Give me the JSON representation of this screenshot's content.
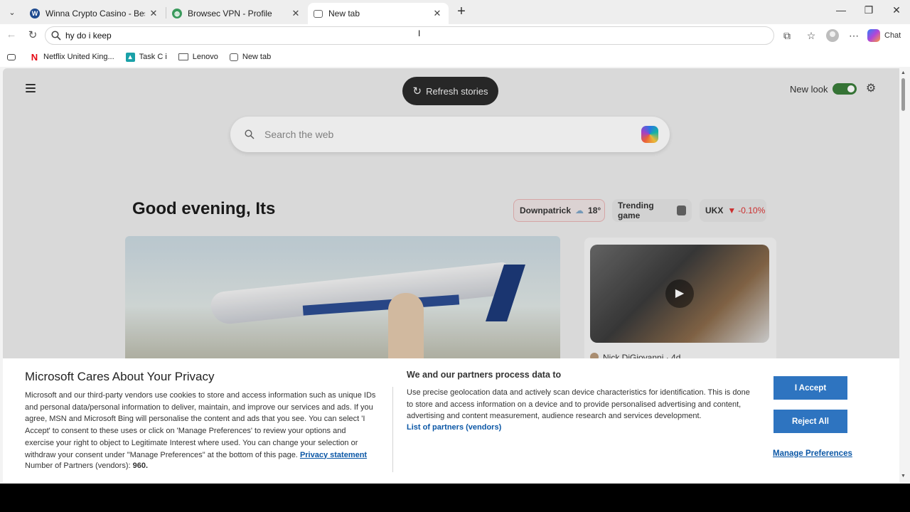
{
  "tabs": [
    {
      "title": "Winna Crypto Casino - Best Crypto",
      "icon": "wordpress-icon",
      "active": false
    },
    {
      "title": "Browsec VPN - Profile",
      "icon": "globe-icon",
      "active": false
    },
    {
      "title": "New tab",
      "icon": "newtab-icon",
      "active": true
    }
  ],
  "address_bar": {
    "value": "hy do i keep"
  },
  "toolbar": {
    "chat_label": "Chat"
  },
  "bookmarks": [
    {
      "label": "Netflix United King...",
      "icon": "netflix-icon"
    },
    {
      "label": "Task C i",
      "icon": "task-icon"
    },
    {
      "label": "Lenovo",
      "icon": "folder-icon"
    },
    {
      "label": "New tab",
      "icon": "newtab-icon"
    }
  ],
  "page": {
    "refresh_label": "Refresh stories",
    "new_look_label": "New look",
    "new_look_enabled": true,
    "search_placeholder": "Search the web",
    "greeting": "Good evening, Its",
    "weather": {
      "location": "Downpatrick",
      "temp": "18°"
    },
    "trending": {
      "label": "Trending game"
    },
    "market": {
      "symbol": "UKX",
      "change": "-0.10%",
      "direction": "down"
    },
    "video_author": "Nick DiGiovanni · 4d"
  },
  "privacy": {
    "title": "Microsoft Cares About Your Privacy",
    "body": "Microsoft and our third-party vendors use cookies to store and access information such as unique IDs and personal data/personal information to deliver, maintain, and improve our services and ads. If you agree, MSN and Microsoft Bing will personalise the content and ads that you see. You can select 'I Accept' to consent to these uses or click on 'Manage Preferences' to review your options and exercise your right to object to Legitimate Interest where used. You can change your selection or withdraw your consent under \"Manage Preferences\" at the bottom of this page.",
    "privacy_link": "Privacy statement",
    "partners_label": "Number of Partners (vendors):",
    "partners_count": "960.",
    "process_title": "We and our partners process data to",
    "process_text": "Use precise geolocation data and actively scan device characteristics for identification. This is done to store and access information on a device and to provide personalised advertising and content, advertising and content measurement, audience research and services development.",
    "partners_link": "List of partners (vendors)",
    "accept_label": "I Accept",
    "reject_label": "Reject All",
    "manage_label": "Manage Preferences"
  },
  "colors": {
    "accent_blue": "#2e74c0",
    "toggle_green": "#3a7d3a",
    "link_blue": "#0b57a6",
    "down_red": "#dd3333"
  }
}
